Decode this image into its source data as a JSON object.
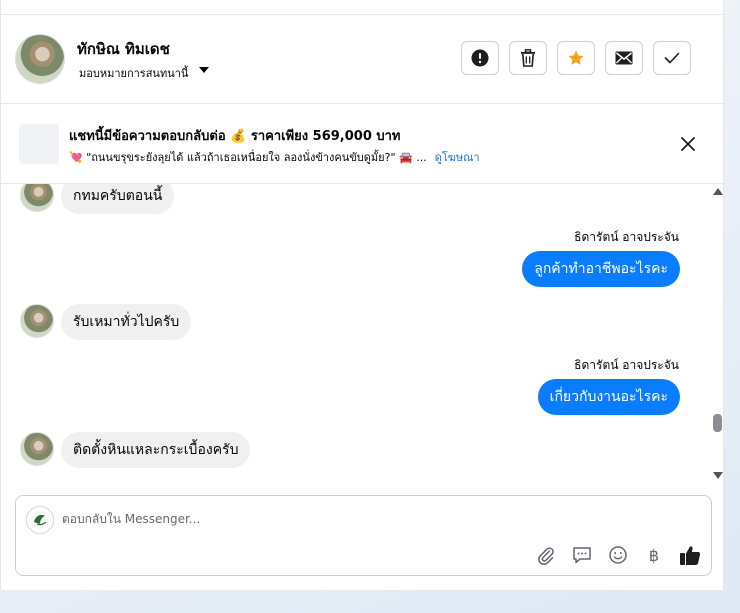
{
  "header": {
    "contact_name": "ทักษิณ ทิมเดช",
    "assign_label": "มอบหมายการสนทนานี้",
    "actions": [
      {
        "name": "spam-button",
        "icon": "exclamation-circle-icon"
      },
      {
        "name": "delete-button",
        "icon": "trash-icon"
      },
      {
        "name": "star-button",
        "icon": "star-icon",
        "color": "#f7a01a"
      },
      {
        "name": "mark-unread-button",
        "icon": "envelope-icon"
      },
      {
        "name": "mark-done-button",
        "icon": "check-icon"
      }
    ]
  },
  "ad_banner": {
    "title": "แชทนี้มีข้อความตอบกลับต่อ 💰 ราคาเพียง 569,000 บาท",
    "subtitle": "💘 \"ถนนขรุขระยังลุยได้ แล้วถ้าเธอเหนื่อยใจ ลองนั่งข้างคนขับดูมั้ย?\" 🚘 ...",
    "link": "ดูโฆษณา"
  },
  "messages": [
    {
      "direction": "in",
      "text": "กทมครับตอนนี้"
    },
    {
      "direction": "out",
      "sender": "ธิดารัตน์ อาจประจัน",
      "text": "ลูกค้าทำอาชีพอะไรคะ"
    },
    {
      "direction": "in",
      "text": "รับเหมาทั่วไปครับ"
    },
    {
      "direction": "out",
      "sender": "ธิดารัตน์ อาจประจัน",
      "text": "เกี่ยวกับงานอะไรคะ"
    },
    {
      "direction": "in",
      "text": "ติดตั้งหินแหละกระเบื้องครับ"
    }
  ],
  "composer": {
    "placeholder": "ตอบกลับใน Messenger...",
    "tools": [
      "paperclip-icon",
      "chat-bubble-icon",
      "smiley-icon",
      "baht-icon",
      "thumbs-up-icon"
    ],
    "baht_symbol": "฿"
  },
  "colors": {
    "outgoing_bubble": "#0a7cff",
    "incoming_bubble": "#f0f0f0",
    "link": "#1b74e4"
  }
}
